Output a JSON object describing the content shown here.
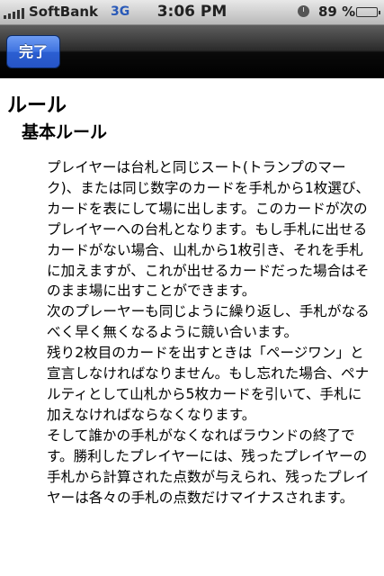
{
  "status_bar": {
    "carrier": "SoftBank",
    "network": "3G",
    "time": "3:06 PM",
    "battery_percent": "89 %",
    "battery_level": 0.89,
    "icons": [
      "signal-bars-icon",
      "clock-icon",
      "battery-icon"
    ]
  },
  "nav_bar": {
    "done_label": "完了"
  },
  "content": {
    "title": "ルール",
    "section_title": "基本ルール",
    "paragraphs": [
      "プレイヤーは台札と同じスート(トランプのマーク)、または同じ数字のカードを手札から1枚選び、カードを表にして場に出します。このカードが次のプレイヤーへの台札となります。もし手札に出せるカードがない場合、山札から1枚引き、それを手札に加えますが、これが出せるカードだった場合はそのまま場に出すことができます。",
      "次のプレーヤーも同じように繰り返し、手札がなるべく早く無くなるように競い合います。",
      "残り2枚目のカードを出すときは「ページワン」と宣言しなければなりません。もし忘れた場合、ペナルティとして山札から5枚カードを引いて、手札に加えなければならなくなります。",
      "そして誰かの手札がなくなればラウンドの終了です。勝利したプレイヤーには、残ったプレイヤーの手札から計算された点数が与えられ、残ったプレイヤーは各々の手札の点数だけマイナスされます。"
    ]
  },
  "colors": {
    "done_button": "#3f73e0",
    "nav_bar": "#000000",
    "battery_fill": "#3bbf2b",
    "network_label": "#2a5ab8"
  }
}
